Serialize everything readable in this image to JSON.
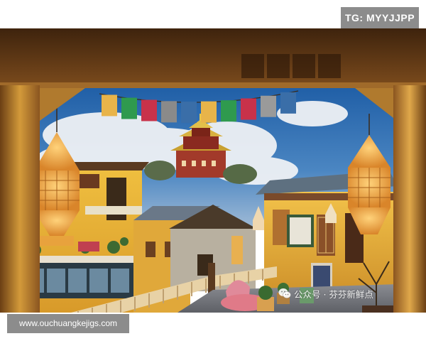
{
  "watermarks": {
    "tag": "TG: MYYJJPP",
    "url": "www.ouchuangkejigs.com",
    "wechat_account": "公众号 · 芬芬新鲜点"
  },
  "scene": {
    "subject": "wooden-balcony-view-of-tibetan-temple",
    "palette": {
      "sky_blue": "#2f6fb0",
      "cloud": "#e6e9ee",
      "wood": "#c9892a",
      "wood_dark": "#5a3414",
      "lantern": "#e89c3a",
      "temple_roof": "#c9a030",
      "floor": "#7d7f86"
    },
    "prayer_flag_colors": [
      "#e8b44a",
      "#2f9a4e",
      "#c8324a",
      "#8a8a8a",
      "#3a6ea8",
      "#e8b44a",
      "#2f9a4e",
      "#c8324a",
      "#9a9a9a",
      "#3a6ea8"
    ]
  }
}
